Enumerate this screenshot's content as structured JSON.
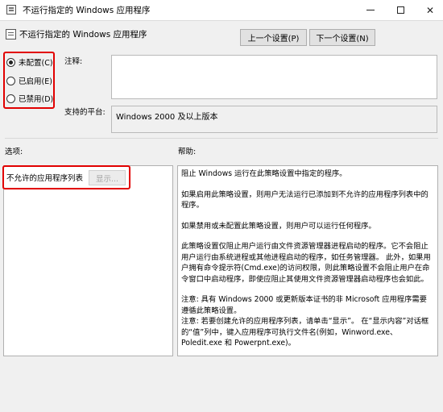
{
  "window": {
    "title": "不运行指定的 Windows 应用程序",
    "minimize": "minimize",
    "maximize": "maximize",
    "close": "✕"
  },
  "header": {
    "policy_name": "不运行指定的 Windows 应用程序",
    "prev_button": "上一个设置(P)",
    "next_button": "下一个设置(N)"
  },
  "state": {
    "not_configured": "未配置(C)",
    "enabled": "已启用(E)",
    "disabled": "已禁用(D)",
    "selected": "not_configured"
  },
  "comment": {
    "label": "注释:",
    "value": ""
  },
  "supported": {
    "label": "支持的平台:",
    "value": "Windows 2000 及以上版本"
  },
  "options": {
    "label": "选项:",
    "item_label": "不允许的应用程序列表",
    "show_button": "显示..."
  },
  "help": {
    "label": "帮助:",
    "paragraphs": [
      "阻止 Windows 运行在此策略设置中指定的程序。",
      "如果启用此策略设置，则用户无法运行已添加到不允许的应用程序列表中的程序。",
      "如果禁用或未配置此策略设置，则用户可以运行任何程序。",
      "此策略设置仅阻止用户运行由文件资源管理器进程启动的程序。它不会阻止用户运行由系统进程或其他进程启动的程序，如任务管理器。 此外，如果用户拥有命令提示符(Cmd.exe)的访问权限，则此策略设置不会阻止用户在命令窗口中启动程序，即使应阻止其使用文件资源管理器启动程序也会如此。",
      "注意: 具有 Windows 2000 或更新版本证书的非 Microsoft 应用程序需要遵循此策略设置。",
      "注意: 若要创建允许的应用程序列表，请单击“显示”。 在“显示内容”对话框的“值”列中，键入应用程序可执行文件名(例如，Winword.exe、Poledit.exe 和 Powerpnt.exe)。"
    ]
  },
  "colors": {
    "highlight": "#e10000",
    "dialog_bg": "#f0f0f0"
  }
}
